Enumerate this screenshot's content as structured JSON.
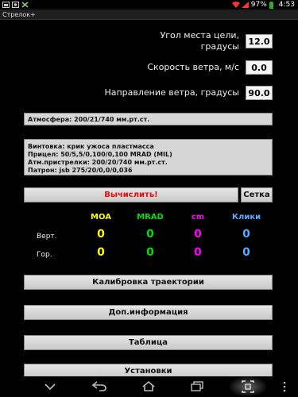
{
  "status": {
    "battery": "97%",
    "time": "4:53"
  },
  "app": {
    "title": "Стрелок+"
  },
  "fields": [
    {
      "label_line1": "Угол места цели,",
      "label_line2": "градусы",
      "value": "12.0"
    },
    {
      "label": "Скорость ветра, м/с",
      "value": "0.0"
    },
    {
      "label": "Направление ветра, градусы",
      "value": "90.0"
    }
  ],
  "atmosphere": "Атмосфера: 200/21/740 мм.рт.ст.",
  "rifle_info": [
    "Винтовка: крик ужоса пластмасса",
    "Прицел: 50/5,5/0,100/0,100 MRAD (MIL)",
    "Атм.пристрелки: 200/20/740 мм.рт.ст.",
    "Патрон: jsb 275/20/0,0/0,036"
  ],
  "actions": {
    "calculate": "Вычислить!",
    "grid": "Сетка"
  },
  "results": {
    "columns": [
      "MOA",
      "MRAD",
      "cm",
      "Клики"
    ],
    "column_colors": [
      "#ffff00",
      "#00e000",
      "#ff00ff",
      "#5aa9ff"
    ],
    "rows": [
      {
        "label": "Верт.",
        "values": [
          "0",
          "0",
          "0",
          "0"
        ]
      },
      {
        "label": "Гор.",
        "values": [
          "0",
          "0",
          "0",
          "0"
        ]
      }
    ]
  },
  "menu": [
    "Калибровка траектории",
    "Доп.информация",
    "Таблица",
    "Установки"
  ]
}
